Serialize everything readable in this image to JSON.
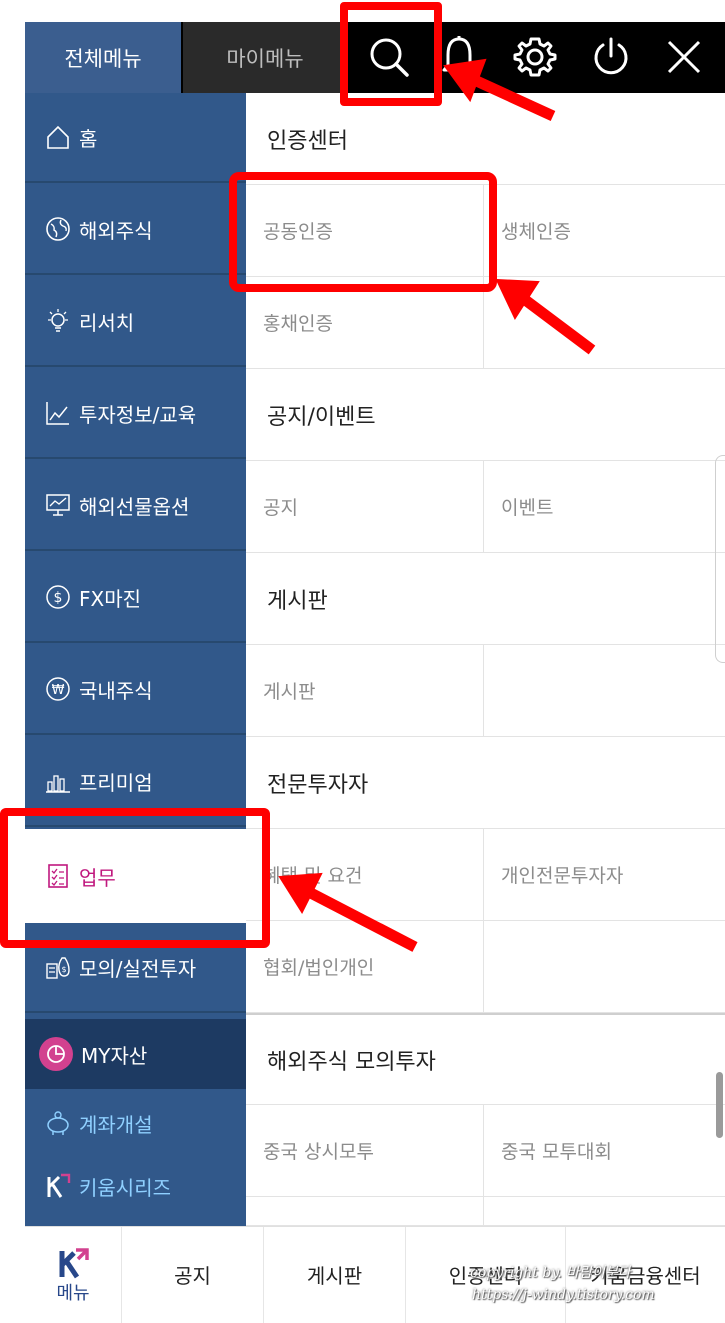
{
  "tabs": {
    "all": "전체메뉴",
    "my": "마이메뉴"
  },
  "top_icons": [
    "search-icon",
    "bell-icon",
    "gear-icon",
    "power-icon",
    "close-icon"
  ],
  "sidebar": {
    "items": [
      {
        "label": "홈",
        "icon": "home-icon"
      },
      {
        "label": "해외주식",
        "icon": "globe-icon"
      },
      {
        "label": "리서치",
        "icon": "lightbulb-icon"
      },
      {
        "label": "투자정보/교육",
        "icon": "chart-icon"
      },
      {
        "label": "해외선물옵션",
        "icon": "monitor-chart-icon"
      },
      {
        "label": "FX마진",
        "icon": "dollar-icon"
      },
      {
        "label": "국내주식",
        "icon": "won-icon"
      },
      {
        "label": "프리미엄",
        "icon": "bar-icon"
      },
      {
        "label": "업무",
        "icon": "checklist-icon"
      },
      {
        "label": "모의/실전투자",
        "icon": "money-bag-icon"
      }
    ],
    "my_asset": "MY자산",
    "links": [
      {
        "label": "계좌개설",
        "icon": "piggy-bank-icon"
      },
      {
        "label": "키움시리즈",
        "icon": "kiwoom-logo-icon"
      }
    ]
  },
  "main": {
    "sections": [
      {
        "title": "인증센터",
        "rows": [
          [
            "공동인증",
            "생체인증"
          ],
          [
            "홍채인증",
            ""
          ]
        ]
      },
      {
        "title": "공지/이벤트",
        "rows": [
          [
            "공지",
            "이벤트"
          ]
        ]
      },
      {
        "title": "게시판",
        "rows": [
          [
            "게시판",
            ""
          ]
        ]
      },
      {
        "title": "전문투자자",
        "rows": [
          [
            "혜택 및 요건",
            "개인전문투자자"
          ],
          [
            "협회/법인개인",
            ""
          ]
        ]
      },
      {
        "title": "해외주식 모의투자",
        "rows": [
          [
            "중국 상시모투",
            "중국 모투대회"
          ]
        ]
      }
    ]
  },
  "bottom": {
    "menu": "메뉴",
    "items": [
      "공지",
      "게시판",
      "인증센터",
      "키움금융센터"
    ]
  },
  "watermark": {
    "line1": "copyright by. 바람이분다",
    "line2": "https://j-windy.tistory.com"
  },
  "colors": {
    "accent_red": "#ff0000",
    "sidebar_blue": "#31588a",
    "active_magenta": "#c0187e"
  }
}
